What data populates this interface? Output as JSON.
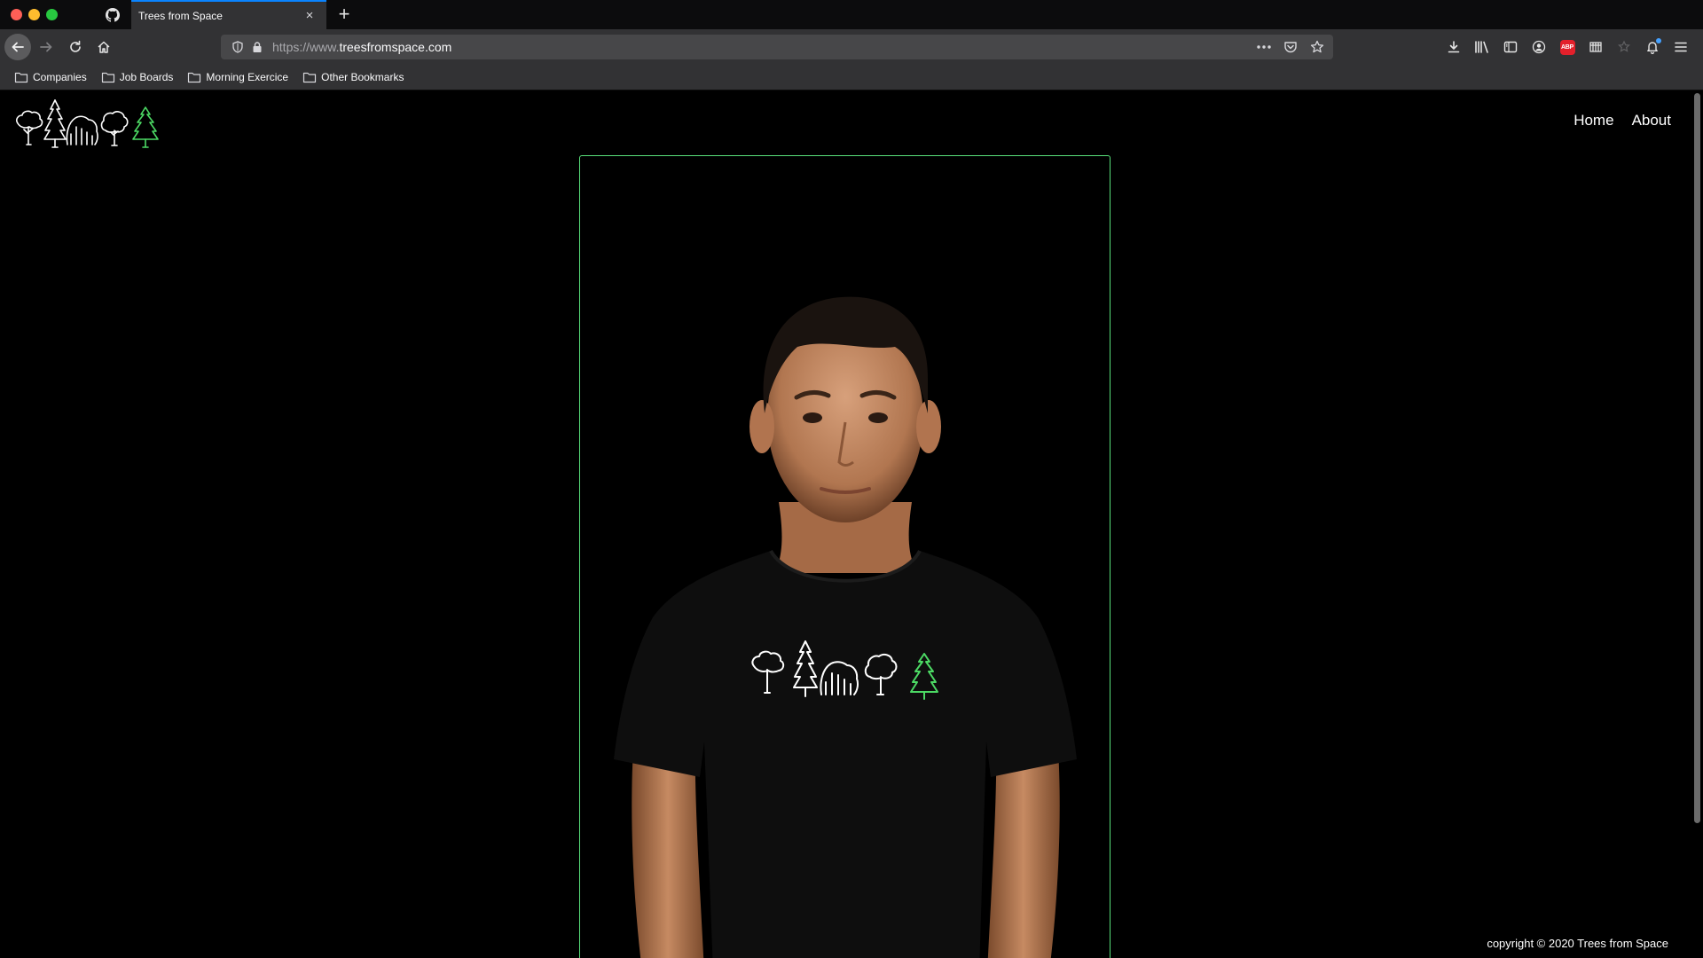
{
  "browser": {
    "tab": {
      "title": "Trees from Space",
      "close_glyph": "×"
    },
    "new_tab_glyph": "+",
    "url": {
      "prefix": "https://www.",
      "host": "treesfromspace.com"
    },
    "abp_label": "ABP",
    "bookmarks": [
      {
        "label": "Companies"
      },
      {
        "label": "Job Boards"
      },
      {
        "label": "Morning Exercice"
      },
      {
        "label": "Other Bookmarks"
      }
    ],
    "icons": {
      "tab": "github-icon",
      "nav": [
        "back-arrow-icon",
        "forward-arrow-icon",
        "reload-icon",
        "home-icon"
      ],
      "url": [
        "shield-icon",
        "lock-icon",
        "more-actions-icon",
        "pocket-icon",
        "star-icon"
      ],
      "toolbar": [
        "download-icon",
        "library-icon",
        "sidebar-icon",
        "account-icon",
        "adblock-plus-icon",
        "extension-icon",
        "extension-icon",
        "notification-icon",
        "menu-icon"
      ]
    }
  },
  "site": {
    "nav": [
      {
        "label": "Home"
      },
      {
        "label": "About"
      }
    ],
    "footer": "copyright © 2020 Trees from Space",
    "logo_colors": {
      "trees": "#ffffff",
      "accent_tree": "#4cd964"
    },
    "frame_color": "#58e07a"
  }
}
